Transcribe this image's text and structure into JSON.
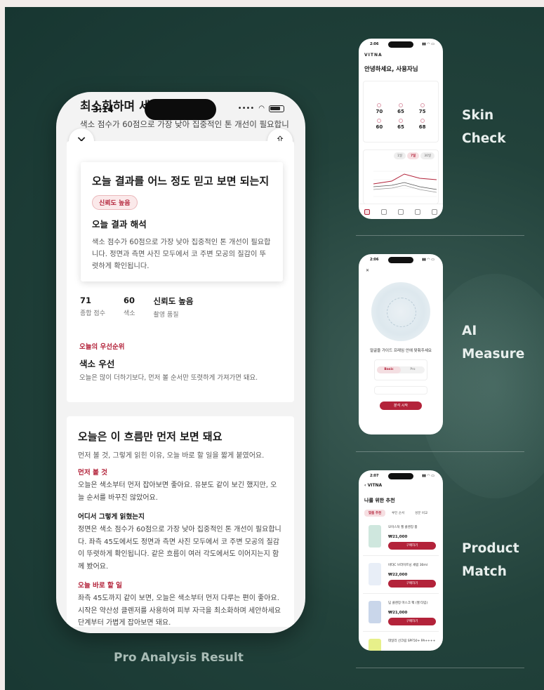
{
  "main_phone": {
    "behind_title": "최소화하며 세안하세요",
    "behind_sub": "색소 점수가 60점으로 가장 낮아 집중적인 톤 개선이 필요합니",
    "time": "3:14",
    "close_glyph": "✕",
    "share_glyph": "⇧",
    "reliability_card": {
      "title": "오늘 결과를 어느 정도 믿고 보면 되는지",
      "badge": "신뢰도 높음",
      "heading": "오늘 결과 해석",
      "body": "색소 점수가 60점으로 가장 낮아 집중적인 톤 개선이 필요합니다. 정면과 측면 사진 모두에서 코 주변 모공의 질감이 뚜렷하게 확인됩니다."
    },
    "stats": [
      {
        "value": "71",
        "label": "종합 점수"
      },
      {
        "value": "60",
        "label": "색소"
      },
      {
        "value": "신뢰도 높음",
        "label": "촬영 품질"
      }
    ],
    "priority": {
      "label": "오늘의 우선순위",
      "title": "색소 우선",
      "desc": "오늘은 많이 더하기보다, 먼저 볼 순서만 또렷하게 가져가면 돼요."
    },
    "flow": {
      "title": "오늘은 이 흐름만 먼저 보면 돼요",
      "subtitle": "먼저 볼 것, 그렇게 읽힌 이유, 오늘 바로 할 일을 짧게 붙였어요.",
      "sections": [
        {
          "heading": "먼저 볼 것",
          "body": "오늘은 색소부터 먼저 잡아보면 좋아요. 유분도 같이 보긴 했지만, 오늘 순서를 바꾸진 않았어요."
        },
        {
          "heading": "어디서 그렇게 읽혔는지",
          "body": "정면은 색소 점수가 60점으로 가장 낮아 집중적인 톤 개선이 필요합니다. 좌측 45도에서도 정면과 측면 사진 모두에서 코 주변 모공의 질감이 뚜렷하게 확인됩니다. 같은 흐름이 여러 각도에서도 이어지는지 함께 봤어요."
        },
        {
          "heading": "오늘 바로 할 일",
          "body": "좌측 45도까지 같이 보면, 오늘은 색소부터 먼저 다루는 편이 좋아요. 시작은 약산성 클렌저를 사용하여 피부 자극을 최소화하며 세안하세요 단계부터 가볍게 잡아보면 돼요."
        }
      ]
    }
  },
  "caption": "Pro Analysis Result",
  "mini_skin": {
    "time": "2:06",
    "logo": "VITNA",
    "greeting": "안녕하세요, 사용자님",
    "scores": [
      "70",
      "65",
      "75",
      "60",
      "65",
      "68"
    ],
    "tabs": [
      "1일",
      "7일",
      "30일"
    ],
    "label_line1": "Skin",
    "label_line2": "Check"
  },
  "mini_measure": {
    "time": "2:06",
    "close_glyph": "✕",
    "guide": "얼굴을 가이드 프레임 안에 맞춰주세요",
    "modes": [
      "Basic",
      "Pro"
    ],
    "button": "분석 시작",
    "label_line1": "AI",
    "label_line2": "Measure"
  },
  "mini_product": {
    "time": "2:07",
    "back": "VITNA",
    "title": "나를 위한 추천",
    "tabs": [
      "맞춤 추천",
      "루틴 순서",
      "성분 비교"
    ],
    "items": [
      {
        "name": "모이스처 젤 클렌징 폼",
        "price": "₩21,000",
        "button": "구매하기"
      },
      {
        "name": "비타C 브라이트닝 세럼 30ml",
        "price": "₩22,000",
        "button": "구매하기"
      },
      {
        "name": "딥 클렌징 마스크 팩 (젤 타입)",
        "price": "₩21,000",
        "button": "구매하기"
      },
      {
        "name": "데일리 선크림 SPF50+ PA++++",
        "price": "",
        "button": ""
      }
    ],
    "label_line1": "Product",
    "label_line2": "Match"
  },
  "colors": {
    "accent": "#b3233a",
    "background": "#22423b"
  }
}
